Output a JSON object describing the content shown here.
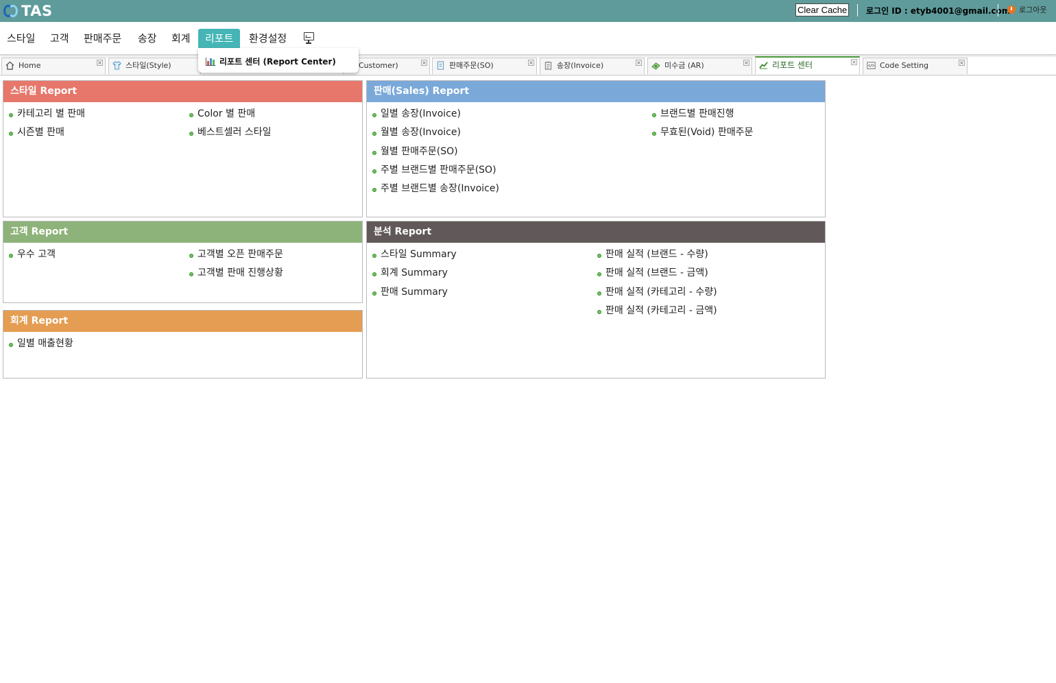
{
  "header": {
    "logo_text": "TAS",
    "clear_cache_label": "Clear Cache",
    "login_label": "로그인 ID : etyb4001@gmail.com",
    "logout_label": "로그아웃",
    "bg_color": "#5f9b9b"
  },
  "nav": {
    "items": [
      {
        "label": "스타일"
      },
      {
        "label": "고객"
      },
      {
        "label": "판매주문"
      },
      {
        "label": "송장"
      },
      {
        "label": "회계"
      },
      {
        "label": "리포트",
        "active": true
      },
      {
        "label": "환경설정"
      }
    ],
    "monitor_icon": "monitor-icon",
    "active_color": "#45b5b5"
  },
  "dropdown": {
    "items": [
      {
        "label": "리포트 센터 (Report Center)",
        "icon": "bar-chart-icon"
      }
    ]
  },
  "tabs": [
    {
      "label": "Home",
      "icon": "home-icon"
    },
    {
      "label": "스타일(Style)",
      "icon": "shirt-icon"
    },
    {
      "label": "Customer)",
      "icon": "customer-icon"
    },
    {
      "label": "판매주문(SO)",
      "icon": "order-icon"
    },
    {
      "label": "송장(Invoice)",
      "icon": "invoice-icon"
    },
    {
      "label": "미수금 (AR)",
      "icon": "money-icon"
    },
    {
      "label": "리포트 센터",
      "icon": "chart-icon",
      "active": true
    },
    {
      "label": "Code Setting",
      "icon": "code-icon"
    }
  ],
  "panels": {
    "style": {
      "title": "스타일 Report",
      "color": "#e6776a",
      "col1": [
        "카테고리 별 판매",
        "시즌별 판매"
      ],
      "col2": [
        "Color 별 판매",
        "베스트셀러 스타일"
      ]
    },
    "sales": {
      "title": "판매(Sales) Report",
      "color": "#7aa9d9",
      "col1": [
        "일별 송장(Invoice)",
        "월별 송장(Invoice)",
        "월별 판매주문(SO)",
        "주별 브랜드별 판매주문(SO)",
        "주별 브랜드별 송장(Invoice)"
      ],
      "col2": [
        "브랜드별 판매진행",
        "무효된(Void) 판매주문"
      ]
    },
    "customer": {
      "title": "고객 Report",
      "color": "#8eb37a",
      "col1": [
        "우수 고객"
      ],
      "col2": [
        "고객별 오픈 판매주문",
        "고객별 판매 진행상황"
      ]
    },
    "analysis": {
      "title": "분석 Report",
      "color": "#615959",
      "col1": [
        "스타일 Summary",
        "회계 Summary",
        "판매 Summary"
      ],
      "col2": [
        "판매 실적 (브랜드 - 수량)",
        "판매 실적 (브랜드 - 금액)",
        "판매 실적 (카테고리 - 수량)",
        "판매 실적 (카테고리 - 금액)"
      ]
    },
    "accounting": {
      "title": "회계 Report",
      "color": "#e49d52",
      "col1": [
        "일별 매출현황"
      ],
      "col2": []
    }
  }
}
